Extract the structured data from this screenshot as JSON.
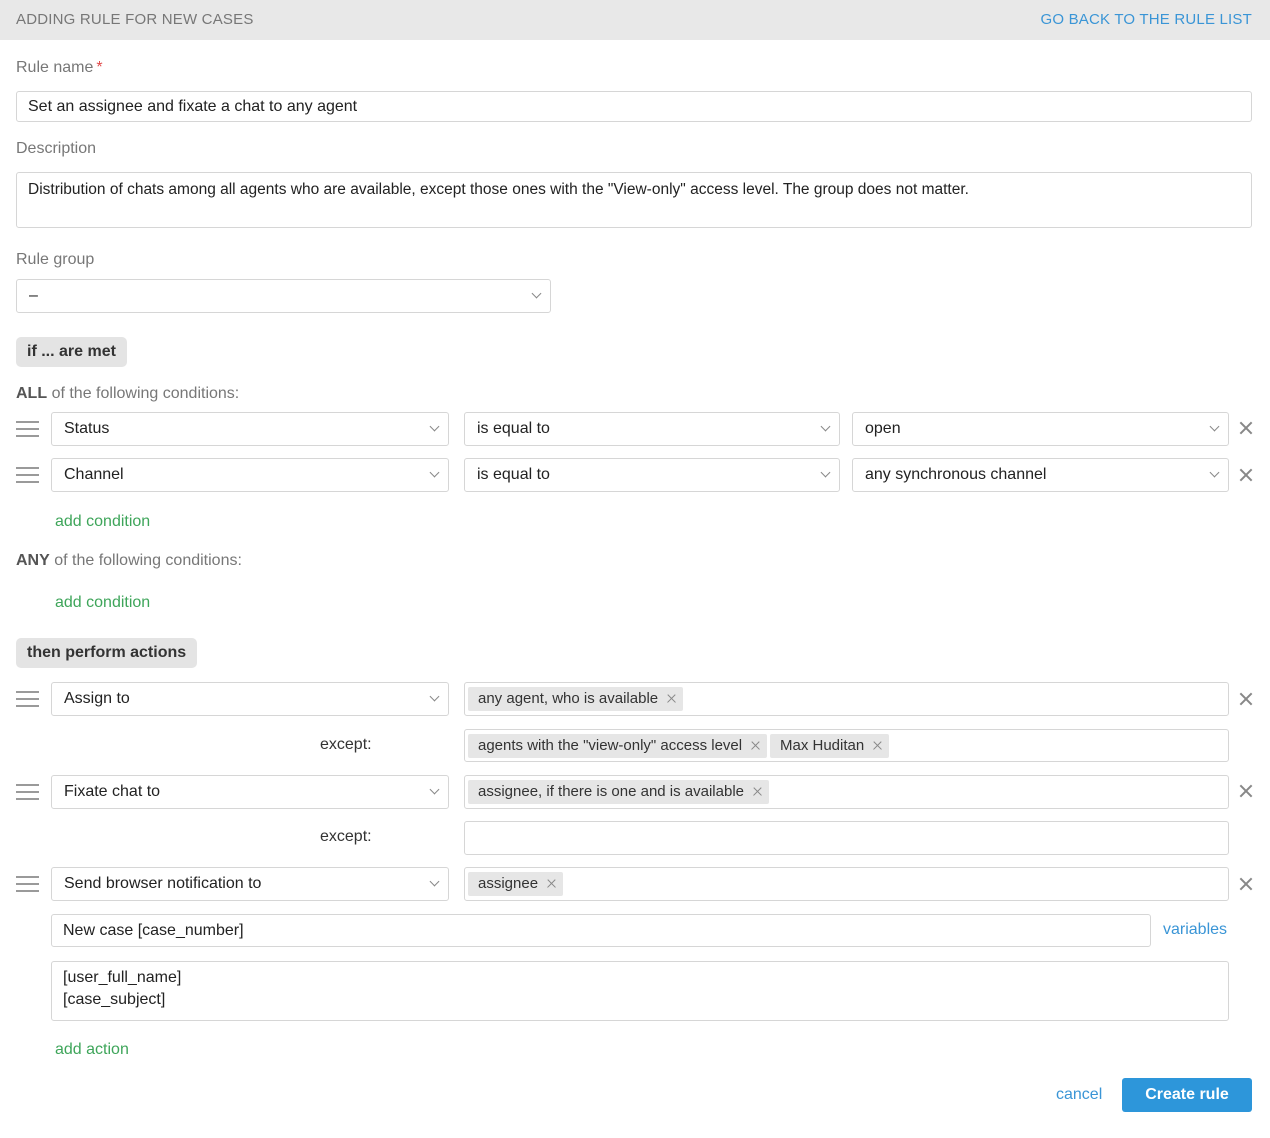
{
  "header": {
    "title": "ADDING RULE FOR NEW CASES",
    "back_link": "GO BACK TO THE RULE LIST"
  },
  "form": {
    "rule_name_label": "Rule name",
    "required_mark": "*",
    "rule_name_value": "Set an assignee and fixate a chat to any agent",
    "description_label": "Description",
    "description_value": "Distribution of chats among all agents who are available, except those ones with the \"View-only\" access level. The group does not matter.",
    "rule_group_label": "Rule group",
    "rule_group_value": "–"
  },
  "conditions": {
    "section_label": "if ... are met",
    "all_keyword": "ALL",
    "all_suffix": "of the following conditions:",
    "rows": [
      {
        "field": "Status",
        "operator": "is equal to",
        "value": "open"
      },
      {
        "field": "Channel",
        "operator": "is equal to",
        "value": "any synchronous channel"
      }
    ],
    "add_condition_all": "add condition",
    "any_keyword": "ANY",
    "any_suffix": "of the following conditions:",
    "add_condition_any": "add condition"
  },
  "actions": {
    "section_label": "then perform actions",
    "except_label": "except:",
    "rows": [
      {
        "type": "Assign to",
        "tags": [
          "any agent, who is available"
        ],
        "except_tags": [
          "agents with the \"view-only\" access level",
          "Max Huditan"
        ]
      },
      {
        "type": "Fixate chat to",
        "tags": [
          "assignee, if there is one and is available"
        ],
        "except_tags": []
      },
      {
        "type": "Send browser notification to",
        "tags": [
          "assignee"
        ]
      }
    ],
    "notification_title": "New case [case_number]",
    "variables_link": "variables",
    "notification_body_line1": "[user_full_name]",
    "notification_body_line2": "[case_subject]",
    "add_action": "add action"
  },
  "footer": {
    "cancel": "cancel",
    "create": "Create rule"
  },
  "colors": {
    "accent_blue": "#2d96da",
    "link_green": "#3ea55a",
    "header_bg": "#e8e8e8"
  }
}
